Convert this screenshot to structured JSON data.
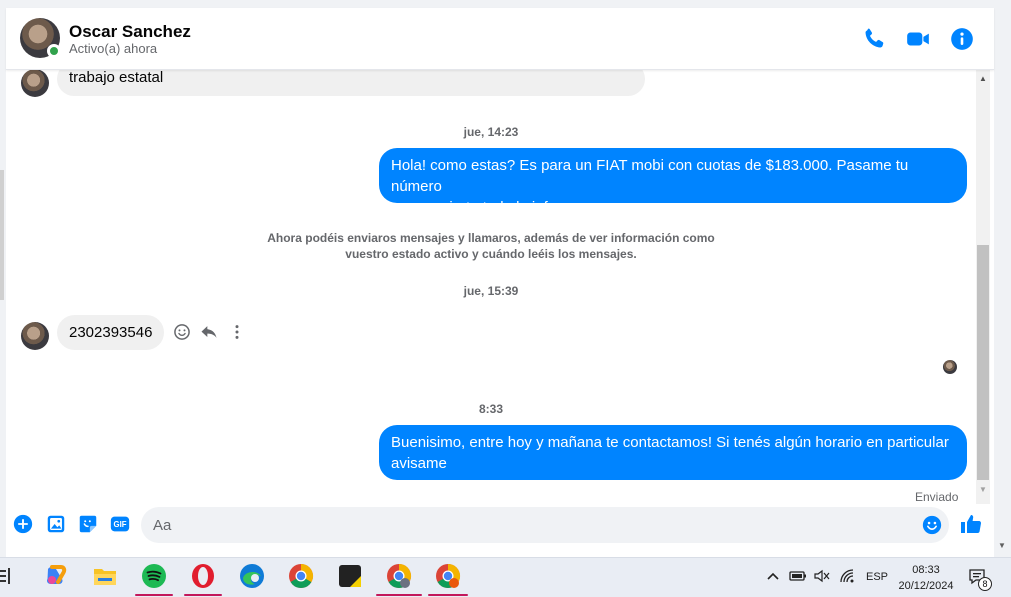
{
  "header": {
    "contact_name": "Oscar Sanchez",
    "status": "Activo(a) ahora",
    "accent": "#0084ff"
  },
  "messages": {
    "partial_in": "trabajo estatal",
    "ts1": "jue, 14:23",
    "out1_line1": "Hola! como estas? Es para un FIAT mobi con cuotas de $183.000. Pasame tu número",
    "out1_line2": "para enviarte toda la info",
    "notice_line1": "Ahora podéis enviaros mensajes y llamaros, además de ver información como",
    "notice_line2": "vuestro estado activo y cuándo leéis los mensajes.",
    "ts2": "jue, 15:39",
    "in_number": "2302393546",
    "ts3": "8:33",
    "out2_line1": "Buenisimo, entre hoy y mañana te contactamos! Si tenés algún horario en particular",
    "out2_line2": "avisame",
    "sent_status": "Enviado"
  },
  "composer": {
    "placeholder": "Aa"
  },
  "taskbar": {
    "apps": [
      "copilot-icon",
      "file-explorer-icon",
      "spotify-icon",
      "opera-icon",
      "edge-icon",
      "chrome-icon",
      "sticky-notes-icon",
      "chrome-profile-icon",
      "chrome-profile-2-icon"
    ],
    "language": "ESP",
    "time": "08:33",
    "date": "20/12/2024",
    "notifications": "8"
  }
}
